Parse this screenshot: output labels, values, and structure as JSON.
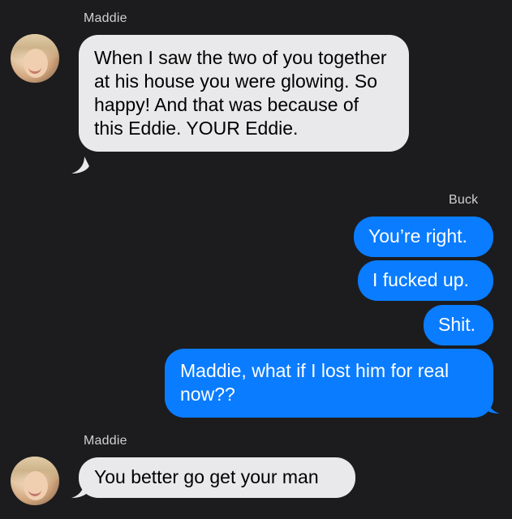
{
  "thread": {
    "group1_sender": "Maddie",
    "group2_sender": "Buck",
    "group3_sender": "Maddie"
  },
  "messages": [
    {
      "from": "Maddie",
      "direction": "incoming",
      "text": "When I saw the two of you together at his house you were glowing. So happy! And that was because of this Eddie. YOUR Eddie."
    },
    {
      "from": "Buck",
      "direction": "outgoing",
      "text": "You’re right."
    },
    {
      "from": "Buck",
      "direction": "outgoing",
      "text": "I fucked up."
    },
    {
      "from": "Buck",
      "direction": "outgoing",
      "text": "Shit."
    },
    {
      "from": "Buck",
      "direction": "outgoing",
      "text": "Maddie, what if I lost him for real now??"
    },
    {
      "from": "Maddie",
      "direction": "incoming",
      "text": "You better go get your man"
    }
  ],
  "colors": {
    "background": "#1c1c1e",
    "incoming_bubble": "#e9e9eb",
    "outgoing_bubble": "#0a7cff"
  },
  "icons": {
    "avatar": "contact-photo-maddie"
  }
}
